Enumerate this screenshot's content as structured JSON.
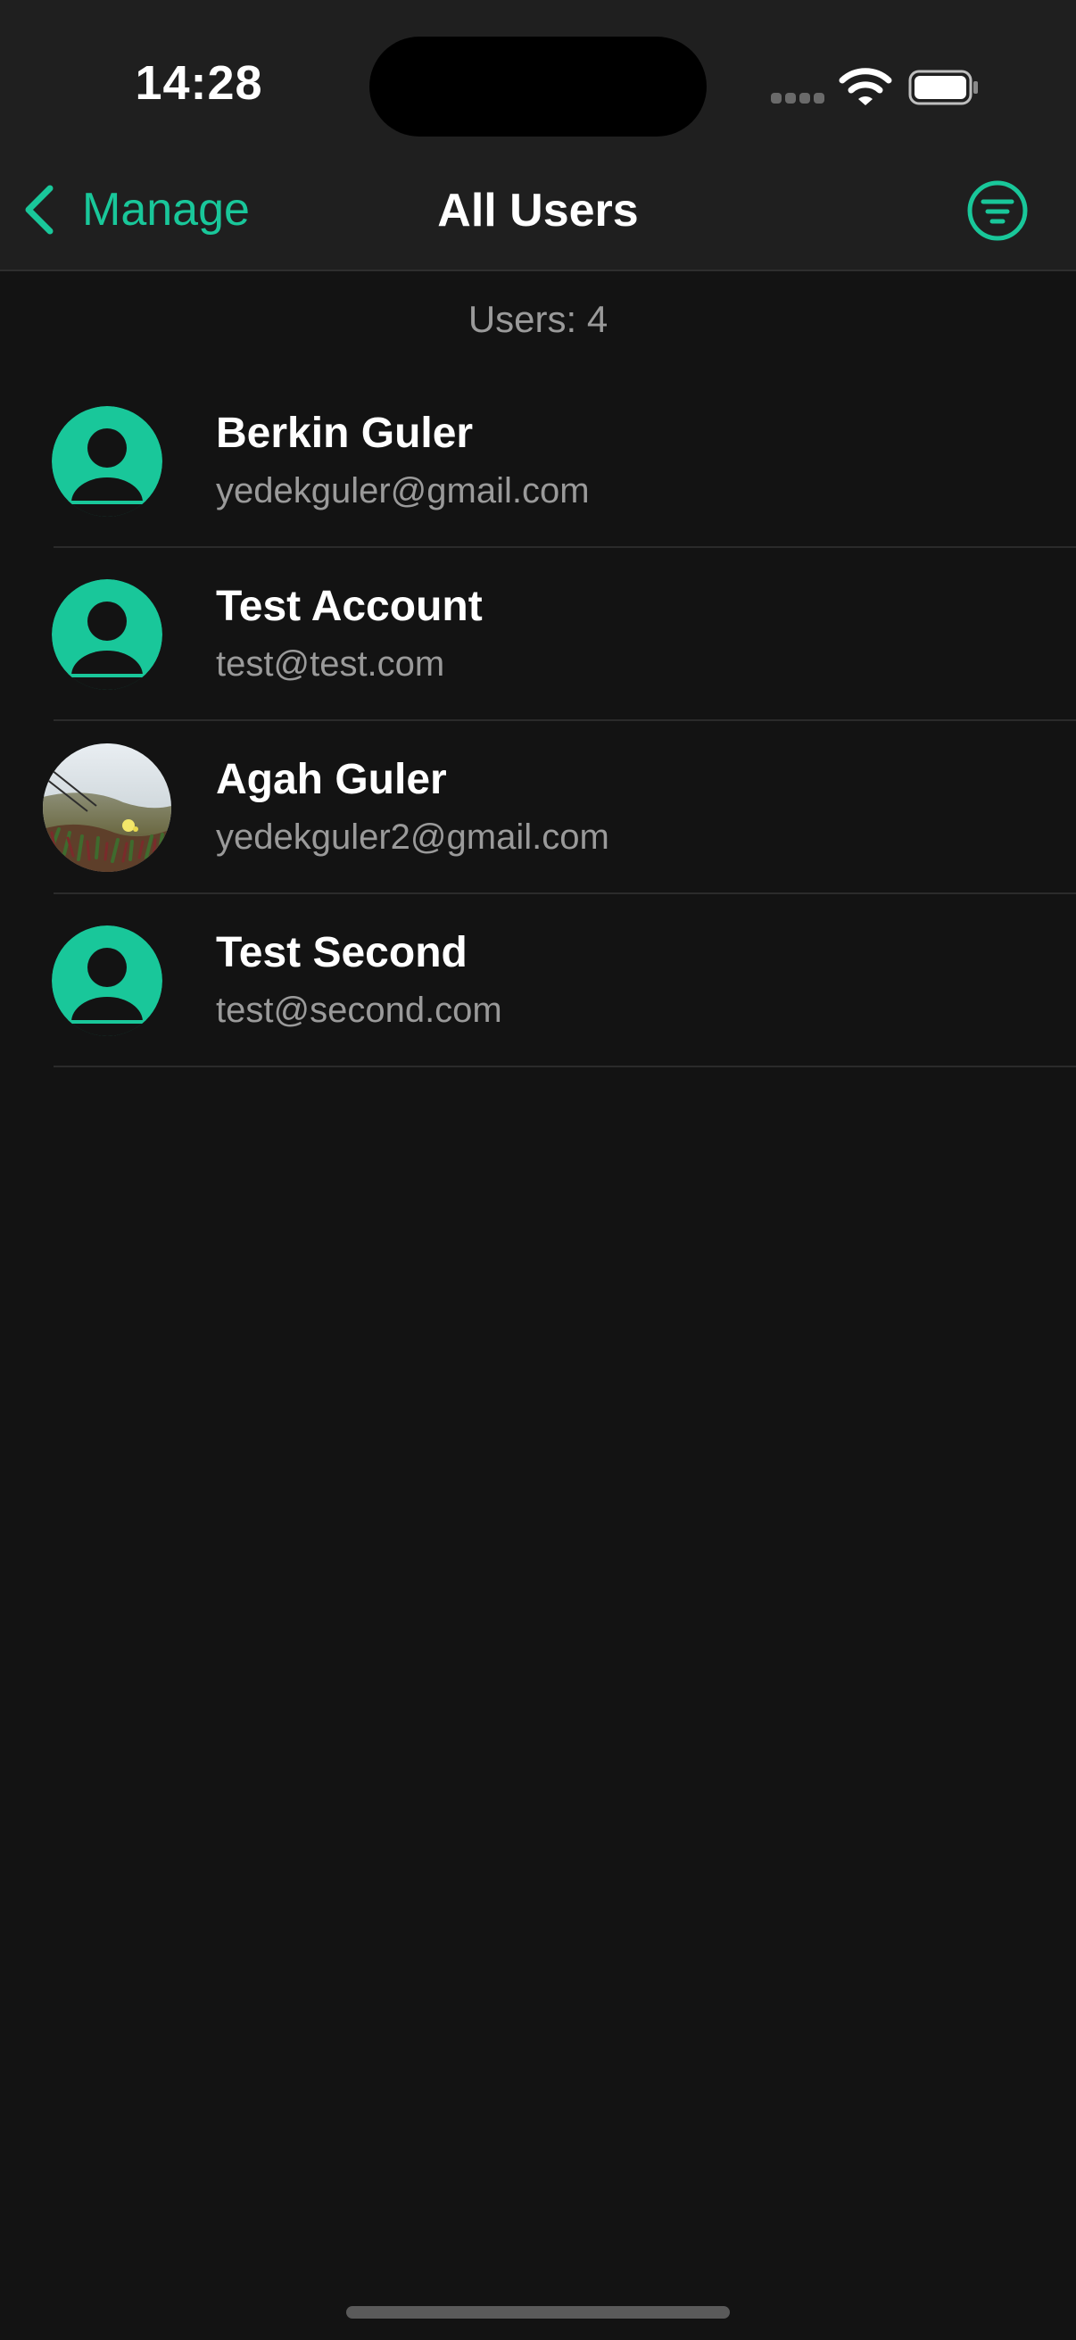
{
  "status_bar": {
    "time": "14:28",
    "icons": [
      "cellular-signal-icon",
      "wifi-icon",
      "battery-icon"
    ]
  },
  "nav": {
    "back_label": "Manage",
    "title": "All Users",
    "filter_icon": "filter-icon"
  },
  "summary": {
    "user_count": "Users: 4"
  },
  "users": [
    {
      "name": "Berkin Guler",
      "email": "yedekguler@gmail.com",
      "avatar": "default-person-icon"
    },
    {
      "name": "Test Account",
      "email": "test@test.com",
      "avatar": "default-person-icon"
    },
    {
      "name": "Agah Guler",
      "email": "yedekguler2@gmail.com",
      "avatar": "photo"
    },
    {
      "name": "Test Second",
      "email": "test@second.com",
      "avatar": "default-person-icon"
    }
  ],
  "colors": {
    "accent": "#19c79a",
    "background": "#131313",
    "bar_background": "#1f1f1f",
    "secondary_text": "#9a9a9a"
  }
}
